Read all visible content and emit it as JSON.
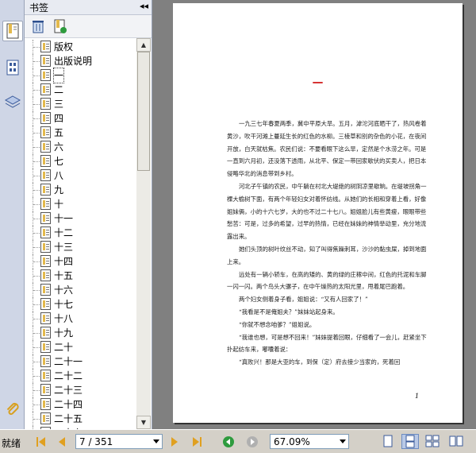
{
  "panel": {
    "title": "书签",
    "collapse_icon": "double-left-arrow-icon",
    "toolbar": [
      "delete-icon",
      "new-bookmark-icon"
    ]
  },
  "rail": [
    "bookmarks-panel-icon",
    "pages-panel-icon",
    "layers-panel-icon",
    "attachments-icon"
  ],
  "bookmarks": [
    "版权",
    "出版说明",
    "一",
    "二",
    "三",
    "四",
    "五",
    "六",
    "七",
    "八",
    "九",
    "十",
    "十一",
    "十二",
    "十三",
    "十四",
    "十五",
    "十六",
    "十七",
    "十八",
    "十九",
    "二十",
    "二十一",
    "二十二",
    "二十三",
    "二十四",
    "二十五",
    "二十六"
  ],
  "selected_index": 2,
  "document": {
    "chapter_title": "一",
    "paragraphs": [
      "一九三七年春夏两季，冀中平原大旱。五月，滹沱河底晒干了，热风卷着黄沙，吹干河滩上蔓延生长的红色的水柳。三棱草和别的杂色的小花，在夜间开放，白天就枯焦。农民们说：不要看眼下这么旱，定然是个水涝之年。可是一直到六月初，还没落下透雨，从北平、保定一带回家歇伏的买卖人，把日本侵略华北的消息带到乡村。",
      "河北子午镇的农民，中午躺在村北大堤绝的树阴凉里歇晌。在堤坡拐角一棵大榆树下面，有两个年轻妇女对着怀纺线。从她们的长相和穿着上看，好像姐妹俩，小的十六七岁，大的也不过二十七八。姐姐脸儿有些黄瘦，眼眼带些愁苦：可是，过多的希望，过早的热情，已经在妹妹的神情举动里，充分地流露出来。",
      "她们头顶的树叶纹丝不动，知了叫得焦躁刺耳，沙沙的黏虫屎，掉到地面上来。",
      "远处有一辆小轿车，在高的矮的、黄的绿的庄稼中间，红色的托泥和车脚一闪一闪。两个鸟头大骡子，在中午燥热的太阳光里，甩着尾巴跑着。",
      "两个妇女侧着身子看，姐姐说：“又有人回家了！”",
      "“我看是不是俺姐夫？”妹妹站起身来。",
      "“你就不想念咱爹？”姐姐说。",
      "“我谁也想，可是想不回来！”妹妹提着回眼，仔细看了一会儿，赶紧坐下扑起纺车来，嘟囔着说：",
      "“真败兴！那是大亚的车，到保（定）府去接少当家的，死着回"
    ],
    "page_number": "1"
  },
  "status": {
    "label": "就绪",
    "page": "7 / 351",
    "zoom": "67.09%",
    "nav_icons": [
      "first-page-icon",
      "prev-page-icon",
      "next-page-icon",
      "last-page-icon",
      "back-icon",
      "forward-icon"
    ],
    "view_icons": [
      "single-page-view-icon",
      "continuous-view-icon",
      "facing-view-icon",
      "continuous-facing-view-icon"
    ]
  },
  "colors": {
    "selected": "#316ac5",
    "chapter_title": "#cc0000",
    "nav_arrow": "#e0a020",
    "back": "#2e9b3e"
  }
}
